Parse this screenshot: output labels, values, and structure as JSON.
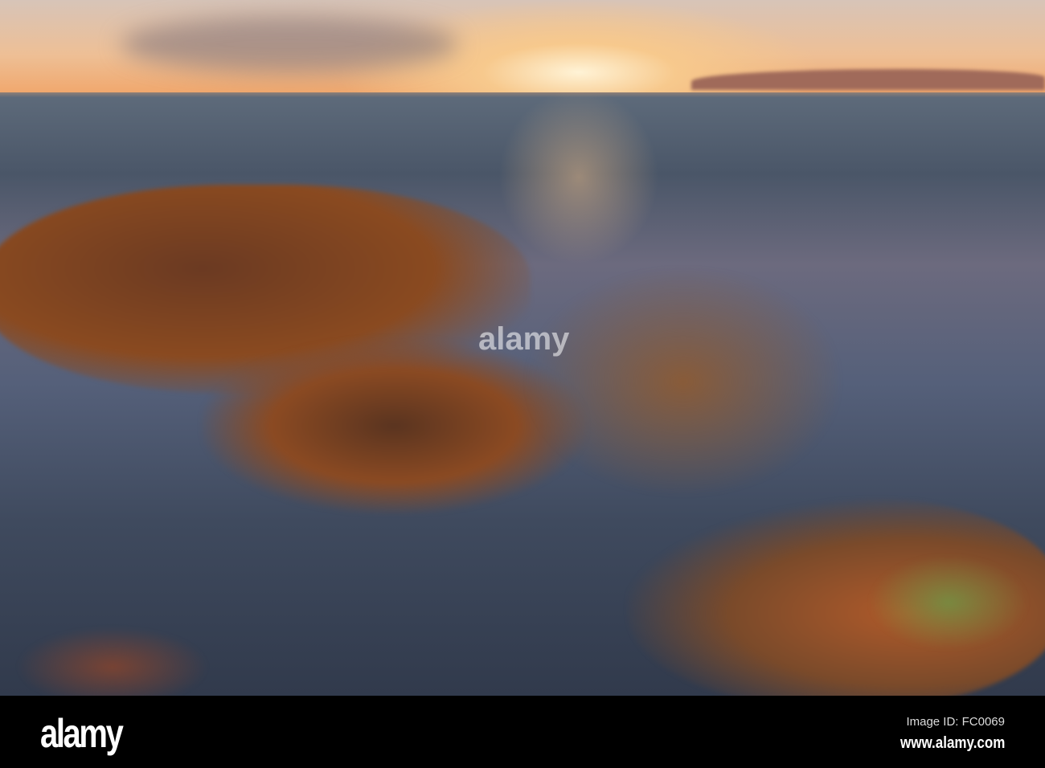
{
  "photo": {
    "description_alt": "Seaweed-covered rocks at the shoreline at sunset"
  },
  "watermark": {
    "text": "alamy"
  },
  "footer": {
    "logo": "alamy",
    "image_id": "Image ID: FC0069",
    "url": "www.alamy.com"
  }
}
